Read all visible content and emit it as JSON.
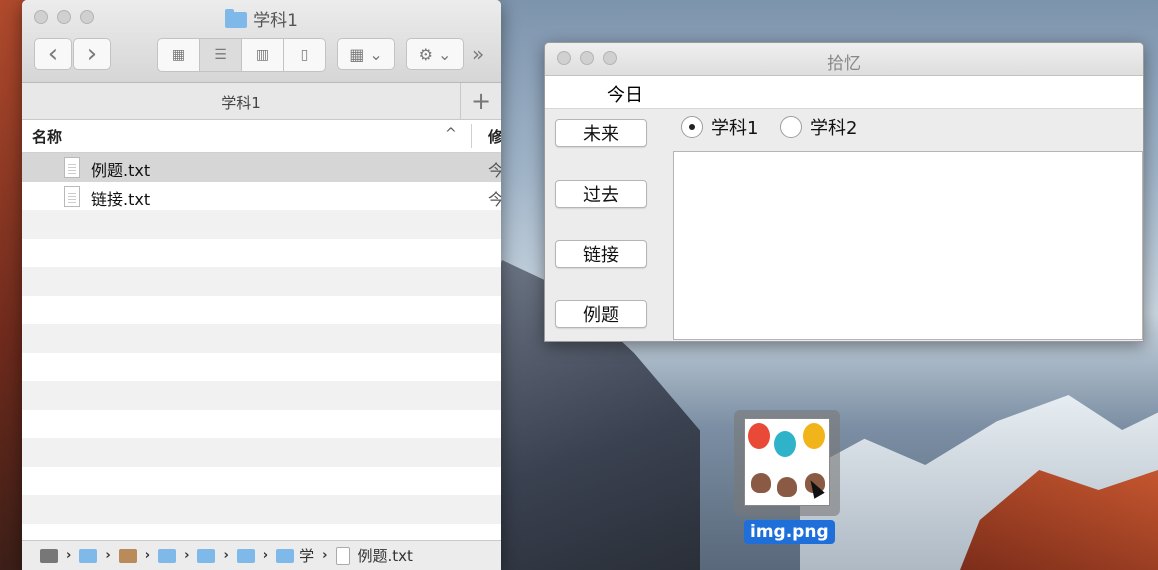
{
  "finder": {
    "title": "学科1",
    "tab_label": "学科1",
    "tab_add": "+",
    "nav_back": "‹",
    "nav_forward": "›",
    "overflow": "»",
    "columns": {
      "name": "名称",
      "sort_indicator": "^",
      "modified": "修"
    },
    "files": [
      {
        "name": "例题.txt",
        "date": "今",
        "selected": true
      },
      {
        "name": "链接.txt",
        "date": "今",
        "selected": false
      }
    ],
    "path": {
      "folder_short": "学",
      "file": "例题.txt"
    }
  },
  "app": {
    "title": "拾忆",
    "menu": {
      "apple": "",
      "today": "今日"
    },
    "buttons": [
      "未来",
      "过去",
      "链接",
      "例题"
    ],
    "radios": [
      {
        "label": "学科1",
        "checked": true
      },
      {
        "label": "学科2",
        "checked": false
      }
    ],
    "text_content": ""
  },
  "drag": {
    "filename": "img.png"
  },
  "colors": {
    "accent": "#1e6fd9",
    "folder": "#7fb9ea"
  }
}
